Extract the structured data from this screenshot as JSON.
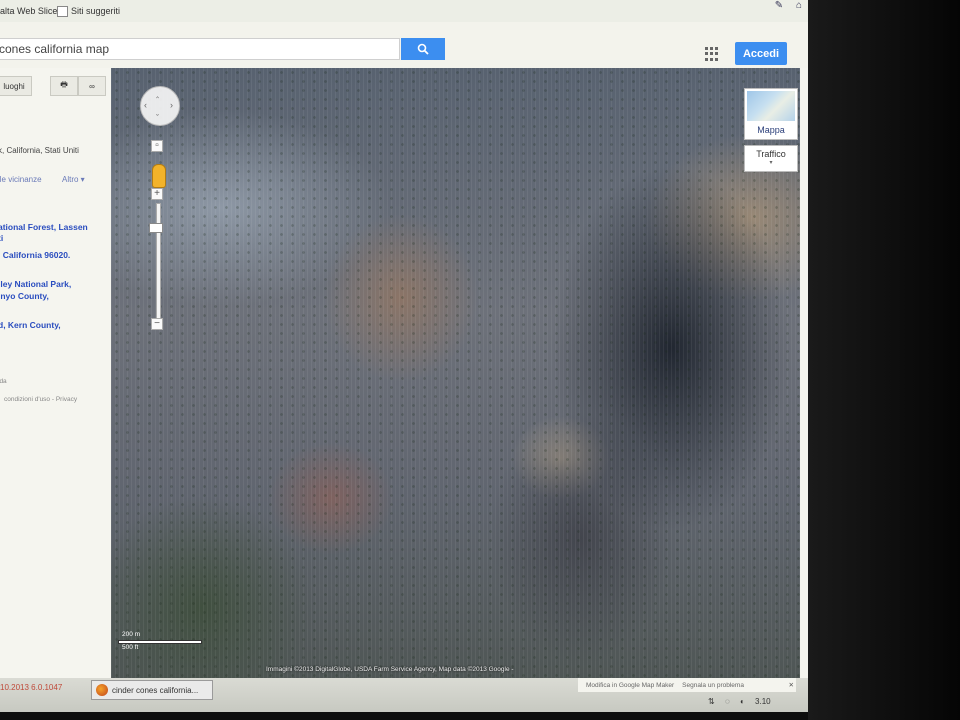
{
  "favorites": [
    {
      "label": "alta Web Slice"
    },
    {
      "label": "Siti suggeriti"
    }
  ],
  "search": {
    "value": "cones california map",
    "placeholder": ""
  },
  "header": {
    "accedi_label": "Accedi"
  },
  "sidebar": {
    "luoghi_label": "luoghi",
    "location_text": "k, California, Stati Uniti",
    "nearby_label": "lle vicinanze",
    "altro_label": "Altro",
    "results": [
      {
        "line1": "ational Forest, Lassen",
        "line2": "ti"
      },
      {
        "line1": ", California 96020.",
        "line2": ""
      },
      {
        "line1": "lley National Park,",
        "line2": "Inyo County,"
      },
      {
        "line1": "d, Kern County,",
        "line2": ""
      }
    ],
    "footer_dash": "ida",
    "footer_terms": "condizioni d'uso - Privacy"
  },
  "map": {
    "maptype_label": "Mappa",
    "traffic_label": "Traffico",
    "scale_top": "200 m",
    "scale_bottom": "500 ft",
    "attribution": "Immagini ©2013 DigitalGlobe, USDA Farm Service Agency, Map data ©2013 Google -"
  },
  "map_footer": {
    "modify": "Modifica in Google Map Maker",
    "report": "Segnala un problema"
  },
  "taskbar": {
    "datetime": "10.2013  6.0.1047",
    "task_label": "cinder cones california...",
    "clock": "3.10"
  },
  "colors": {
    "accent": "#3c8ef0",
    "link": "#2a4dbf"
  }
}
